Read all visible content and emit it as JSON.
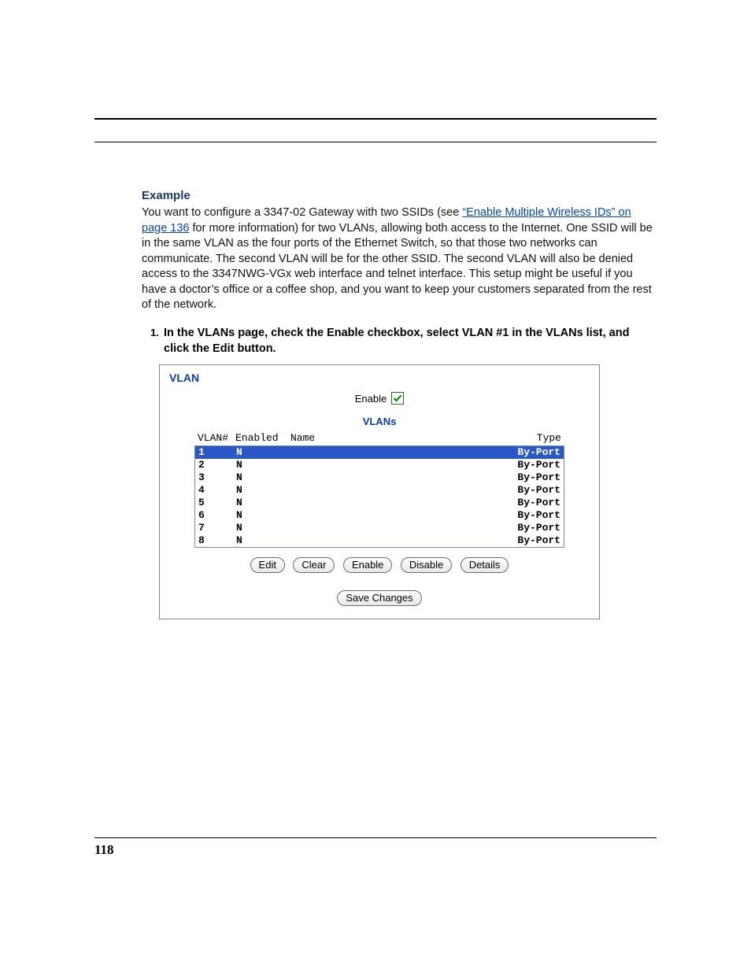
{
  "heading": "Example",
  "para_text_1": "You want to configure a 3347-02 Gateway with two SSIDs (see ",
  "link_text": "“Enable Multiple Wireless IDs” on page 136",
  "para_text_2": " for more information) for two VLANs, allowing both access to the Internet. One SSID will be in the same VLAN as the four ports of the Ethernet Switch, so that those two networks can communicate. The second VLAN will be for the other SSID. The second VLAN will also be denied access to the 3347NWG-VGx web interface and telnet interface. This setup might be useful if you have a doctor’s office or a coffee shop, and you want to keep your customers separated from the rest of the network.",
  "step_number": "1.",
  "step_text": "In the VLANs page, check the Enable checkbox, select VLAN #1 in the VLANs list, and click the Edit button.",
  "panel": {
    "title": "VLAN",
    "enable_label": "Enable",
    "subheading": "VLANs",
    "columns": {
      "num": "VLAN#",
      "enabled": "Enabled",
      "name": "Name",
      "type": "Type"
    },
    "rows": [
      {
        "num": "1",
        "enabled": "N",
        "name": "",
        "type": "By-Port",
        "selected": true
      },
      {
        "num": "2",
        "enabled": "N",
        "name": "",
        "type": "By-Port",
        "selected": false
      },
      {
        "num": "3",
        "enabled": "N",
        "name": "",
        "type": "By-Port",
        "selected": false
      },
      {
        "num": "4",
        "enabled": "N",
        "name": "",
        "type": "By-Port",
        "selected": false
      },
      {
        "num": "5",
        "enabled": "N",
        "name": "",
        "type": "By-Port",
        "selected": false
      },
      {
        "num": "6",
        "enabled": "N",
        "name": "",
        "type": "By-Port",
        "selected": false
      },
      {
        "num": "7",
        "enabled": "N",
        "name": "",
        "type": "By-Port",
        "selected": false
      },
      {
        "num": "8",
        "enabled": "N",
        "name": "",
        "type": "By-Port",
        "selected": false
      }
    ],
    "buttons": {
      "edit": "Edit",
      "clear": "Clear",
      "enable": "Enable",
      "disable": "Disable",
      "details": "Details",
      "save": "Save Changes"
    }
  },
  "page_number": "118"
}
